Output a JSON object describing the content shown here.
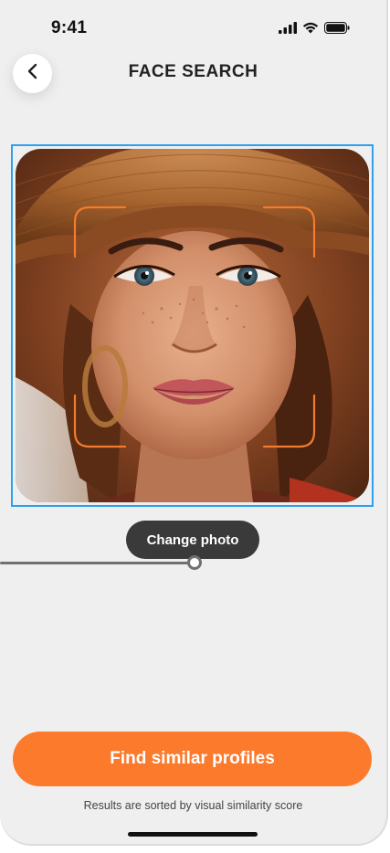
{
  "status_bar": {
    "time": "9:41",
    "icons": [
      "cellular-signal-icon",
      "wifi-icon",
      "battery-icon"
    ]
  },
  "header": {
    "back_icon": "chevron-left-icon",
    "title": "FACE SEARCH"
  },
  "photo": {
    "description_icon": "face-photo",
    "frame_color": "#2ea0ee",
    "corner_bracket_color": "#f27b2e"
  },
  "actions": {
    "change_photo_label": "Change photo",
    "find_button_label": "Find similar profiles"
  },
  "footer": {
    "note": "Results are sorted by visual similarity score"
  },
  "colors": {
    "accent": "#fc7a2c",
    "background": "#efefef",
    "dark_pill": "#3a3a3a"
  }
}
